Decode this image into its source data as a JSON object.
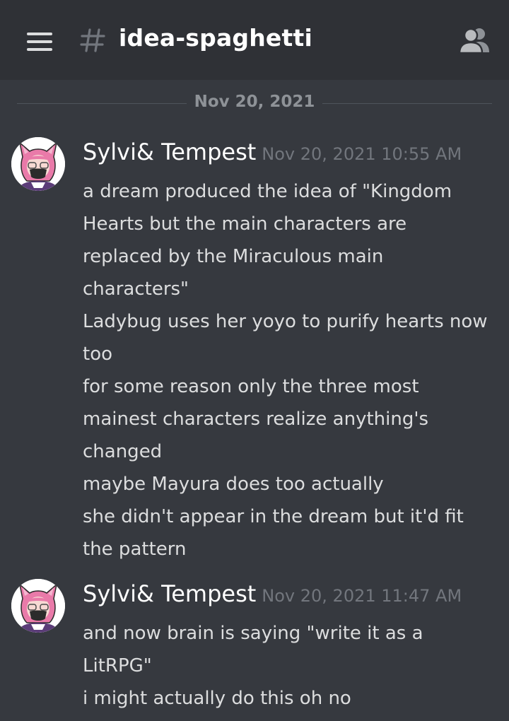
{
  "header": {
    "channel_name": "idea-spaghetti",
    "menu_icon": "hamburger-menu-icon",
    "channel_icon": "hash-icon",
    "members_icon": "members-icon"
  },
  "date_divider": {
    "label": "Nov 20, 2021"
  },
  "messages": [
    {
      "author": "Sylvi& Tempest",
      "timestamp": "Nov 20, 2021 10:55 AM",
      "lines": [
        "a dream produced the idea of \"Kingdom",
        "Hearts but the main characters are",
        "replaced by the Miraculous main",
        "characters\"",
        "Ladybug uses her yoyo to purify hearts now",
        "too",
        "for some reason only the three most",
        "mainest characters realize anything's",
        "changed",
        "maybe Mayura does too actually",
        "she didn't appear in the dream but it'd fit",
        "the pattern"
      ]
    },
    {
      "author": "Sylvi& Tempest",
      "timestamp": "Nov 20, 2021 11:47 AM",
      "lines": [
        "and now brain is saying \"write it as a",
        "LitRPG\"",
        "i might actually do this oh no"
      ]
    }
  ],
  "colors": {
    "background": "#36393f",
    "header_background": "#2f3136",
    "text": "#dcddde",
    "author": "#ffffff",
    "muted": "#72767d"
  }
}
